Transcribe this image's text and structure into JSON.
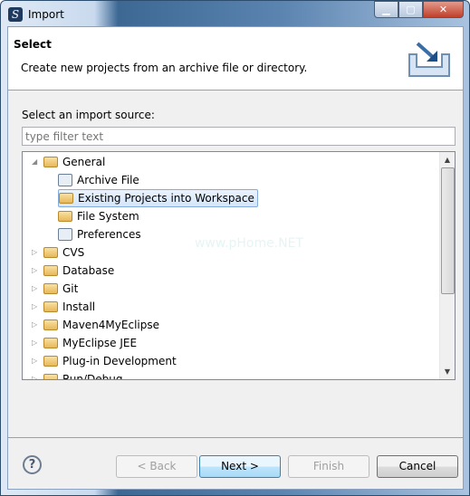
{
  "window": {
    "title": "Import",
    "minimize": "▁",
    "maximize": "▢",
    "close": "✕"
  },
  "header": {
    "title": "Select",
    "description": "Create new projects from an archive file or directory.",
    "icon": "import-wizard-icon"
  },
  "source_label": "Select an import source:",
  "filter": {
    "value": "",
    "placeholder": "type filter text"
  },
  "tree": [
    {
      "label": "General",
      "expanded": true,
      "level": 0,
      "icon": "folder-icon"
    },
    {
      "label": "Archive File",
      "level": 1,
      "icon": "archive-icon"
    },
    {
      "label": "Existing Projects into Workspace",
      "level": 1,
      "icon": "project-folder-icon",
      "selected": true
    },
    {
      "label": "File System",
      "level": 1,
      "icon": "folder-icon"
    },
    {
      "label": "Preferences",
      "level": 1,
      "icon": "preferences-icon"
    },
    {
      "label": "CVS",
      "level": 0,
      "icon": "folder-icon"
    },
    {
      "label": "Database",
      "level": 0,
      "icon": "folder-icon"
    },
    {
      "label": "Git",
      "level": 0,
      "icon": "folder-icon"
    },
    {
      "label": "Install",
      "level": 0,
      "icon": "folder-icon"
    },
    {
      "label": "Maven4MyEclipse",
      "level": 0,
      "icon": "folder-icon"
    },
    {
      "label": "MyEclipse JEE",
      "level": 0,
      "icon": "folder-icon"
    },
    {
      "label": "Plug-in Development",
      "level": 0,
      "icon": "folder-icon"
    },
    {
      "label": "Run/Debug",
      "level": 0,
      "icon": "folder-icon"
    }
  ],
  "watermark": "www.pHome.NET",
  "buttons": {
    "help": "?",
    "back": "< Back",
    "next": "Next >",
    "finish": "Finish",
    "cancel": "Cancel"
  }
}
